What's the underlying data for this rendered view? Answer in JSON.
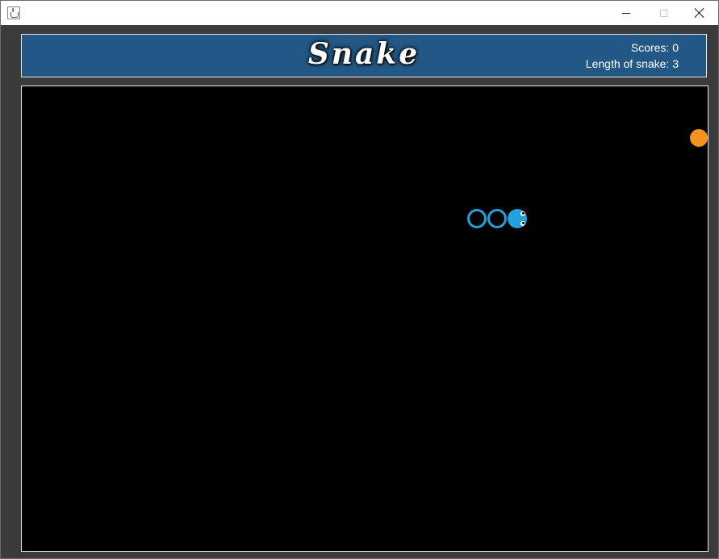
{
  "window": {
    "icon": "java-cup-icon",
    "controls": [
      "minimize-icon",
      "maximize-icon",
      "close-icon"
    ]
  },
  "header": {
    "title": "Snake",
    "score_text": "Scores: 0",
    "length_text": "Length of snake: 3"
  },
  "game": {
    "grid_cols": 34,
    "grid_rows": 23,
    "snake_direction": "right",
    "snake": [
      {
        "col": 22,
        "row": 6,
        "part": "body"
      },
      {
        "col": 23,
        "row": 6,
        "part": "body"
      },
      {
        "col": 24,
        "row": 6,
        "part": "head"
      }
    ],
    "food": {
      "col": 33,
      "row": 2
    }
  },
  "colors": {
    "header_bg": "#235785",
    "board_bg": "#000000",
    "snake": "#22a2dc",
    "food": "#f7921e",
    "frame": "#3b3b3b"
  }
}
